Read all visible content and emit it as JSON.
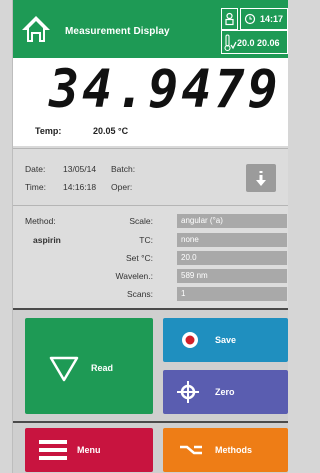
{
  "header": {
    "title": "Measurement Display",
    "time": "14:17",
    "temp_readout": "20.0  20.06",
    "icons": {
      "home": "home-icon",
      "user": "user-icon",
      "clock": "clock-icon",
      "thermo": "thermometer-icon"
    }
  },
  "display": {
    "value": "34.9479",
    "temp_label": "Temp:",
    "temp_value": "20.05 °C"
  },
  "info": {
    "date_label": "Date:",
    "date_value": "13/05/14",
    "batch_label": "Batch:",
    "time_label": "Time:",
    "time_value": "14:16:18",
    "oper_label": "Oper:"
  },
  "method": {
    "label": "Method:",
    "name": "aspirin",
    "rows": [
      {
        "label": "Scale:",
        "value": "angular (°a)"
      },
      {
        "label": "TC:",
        "value": "none"
      },
      {
        "label": "Set °C:",
        "value": "20.0"
      },
      {
        "label": "Wavelen.:",
        "value": "589 nm"
      },
      {
        "label": "Scans:",
        "value": "1"
      }
    ]
  },
  "buttons": {
    "read": "Read",
    "save": "Save",
    "zero": "Zero",
    "menu": "Menu",
    "methods": "Methods"
  },
  "colors": {
    "header_green": "#1e9a55",
    "read_green": "#1e9a55",
    "save_blue": "#1f8fbf",
    "zero_purple": "#5a5db0",
    "menu_red": "#c8143f",
    "methods_orange": "#ee7d16"
  }
}
